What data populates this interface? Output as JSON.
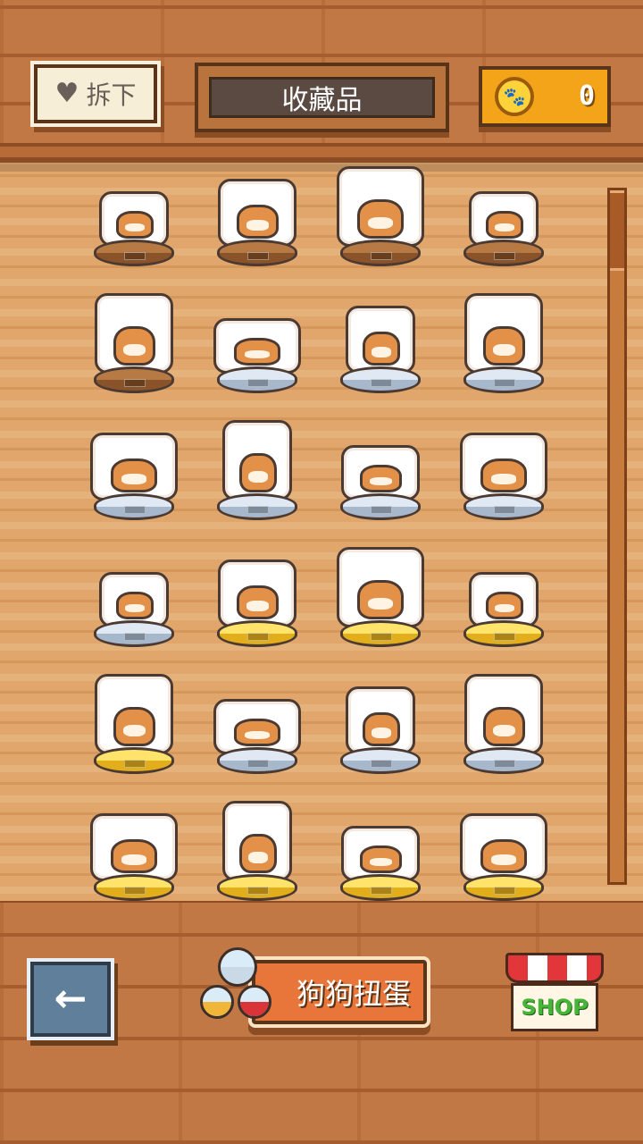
{
  "header": {
    "unequip_label": "拆下",
    "title": "收藏品",
    "coin_count": "0"
  },
  "shelf": {
    "scroll_fraction": 0.0,
    "rows": [
      [
        "wood",
        "wood",
        "wood",
        "wood"
      ],
      [
        "wood",
        "silver",
        "silver",
        "silver"
      ],
      [
        "silver",
        "silver",
        "silver",
        "silver"
      ],
      [
        "silver",
        "gold",
        "gold",
        "gold"
      ],
      [
        "gold",
        "silver",
        "silver",
        "silver"
      ],
      [
        "gold",
        "gold",
        "gold",
        "gold"
      ]
    ]
  },
  "footer": {
    "gacha_label": "狗狗扭蛋",
    "shop_label": "SHOP"
  },
  "colors": {
    "coin": "#f4a418",
    "gacha": "#e8763a",
    "shop_text": "#47b53a",
    "back": "#5f7f9a"
  },
  "icons": {
    "unequip": "heart-icon",
    "coin": "paw-coin-icon",
    "back": "left-arrow-icon",
    "gacha": "capsule-icon",
    "shop": "shop-awning-icon"
  }
}
